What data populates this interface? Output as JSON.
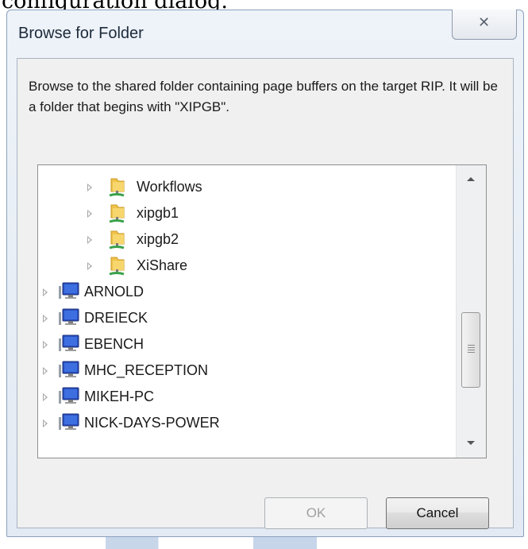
{
  "page": {
    "caption": "configuration dialog."
  },
  "dialog": {
    "title": "Browse for Folder",
    "close_glyph": "✕",
    "description": "Browse to the shared folder containing page buffers on the target RIP. It will be a folder that begins with \"XIPGB\".",
    "ok_label": "OK",
    "cancel_label": "Cancel"
  },
  "tree": {
    "items": [
      {
        "label": "Workflows",
        "icon": "shared-folder-icon"
      },
      {
        "label": "xipgb1",
        "icon": "shared-folder-icon"
      },
      {
        "label": "xipgb2",
        "icon": "shared-folder-icon"
      },
      {
        "label": "XiShare",
        "icon": "shared-folder-icon"
      },
      {
        "label": "ARNOLD",
        "icon": "computer-icon"
      },
      {
        "label": "DREIECK",
        "icon": "computer-icon"
      },
      {
        "label": "EBENCH",
        "icon": "computer-icon"
      },
      {
        "label": "MHC_RECEPTION",
        "icon": "computer-icon"
      },
      {
        "label": "MIKEH-PC",
        "icon": "computer-icon"
      },
      {
        "label": "NICK-DAYS-POWER",
        "icon": "computer-icon"
      }
    ]
  },
  "colors": {
    "accent": "#8aa0bd",
    "folder": "#f0c24a",
    "share_base": "#3aa14a",
    "monitor": "#2a4fbf"
  }
}
